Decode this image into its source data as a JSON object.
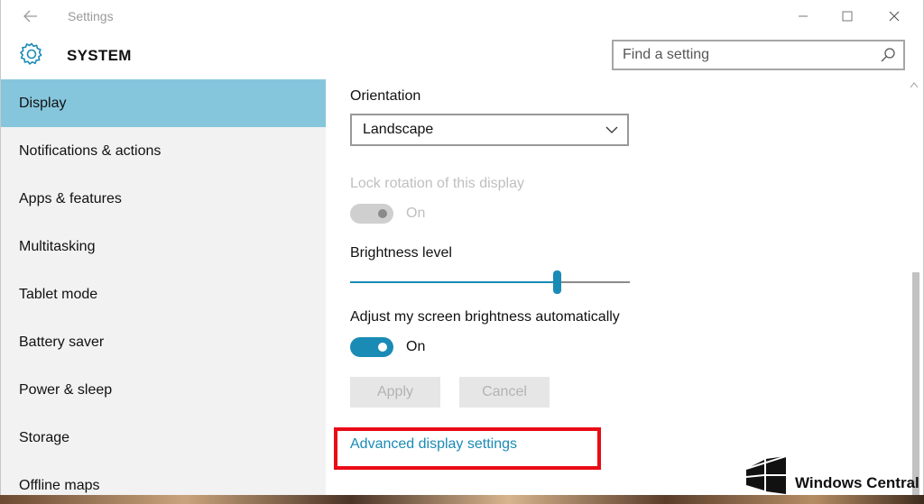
{
  "window": {
    "title": "Settings"
  },
  "header": {
    "title": "SYSTEM",
    "search_placeholder": "Find a setting"
  },
  "sidebar": {
    "items": [
      {
        "label": "Display",
        "active": true
      },
      {
        "label": "Notifications & actions"
      },
      {
        "label": "Apps & features"
      },
      {
        "label": "Multitasking"
      },
      {
        "label": "Tablet mode"
      },
      {
        "label": "Battery saver"
      },
      {
        "label": "Power & sleep"
      },
      {
        "label": "Storage"
      },
      {
        "label": "Offline maps"
      }
    ]
  },
  "content": {
    "orientation_label": "Orientation",
    "orientation_value": "Landscape",
    "lock_rotation_label": "Lock rotation of this display",
    "lock_rotation_state": "On",
    "brightness_label": "Brightness level",
    "brightness_level_fraction": 0.74,
    "auto_brightness_label": "Adjust my screen brightness automatically",
    "auto_brightness_state": "On",
    "apply_label": "Apply",
    "cancel_label": "Cancel",
    "advanced_link": "Advanced display settings"
  },
  "watermark": {
    "text": "Windows Central"
  },
  "colors": {
    "accent": "#1a8bb5",
    "selected_nav": "#86c6dc",
    "highlight_box": "#ea0b16"
  }
}
